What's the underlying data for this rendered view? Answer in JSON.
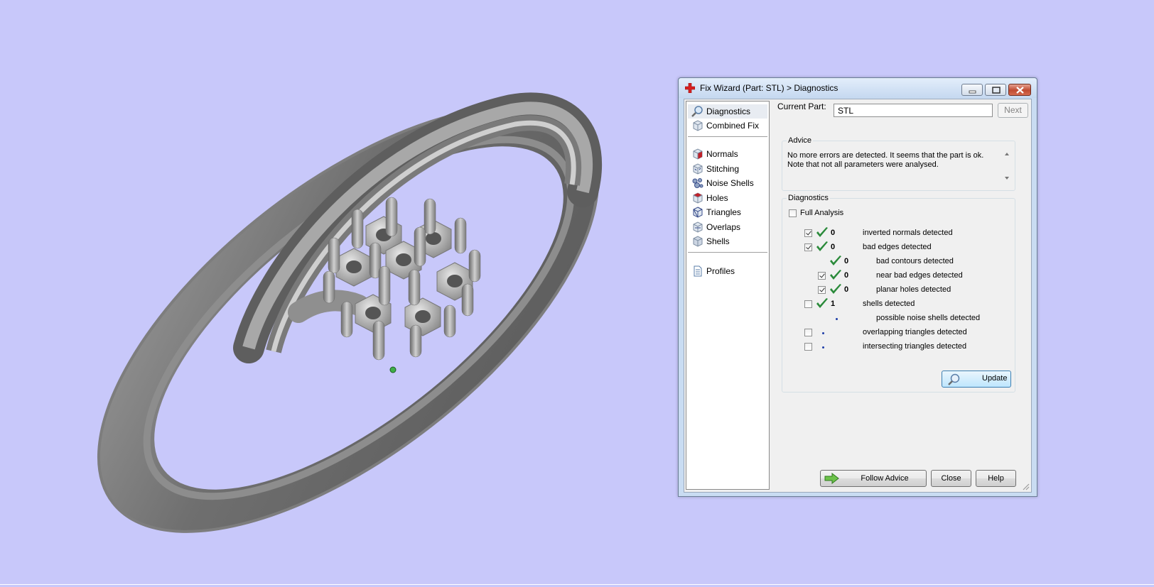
{
  "colors": {
    "viewport_bg": "#c8c8fa",
    "check_green": "#2a8a3a",
    "dot_blue": "#1f3ea8",
    "window_frame": "#c9dcf2"
  },
  "window": {
    "title": "Fix Wizard (Part: STL) > Diagnostics"
  },
  "nav": {
    "top": [
      {
        "label": "Diagnostics",
        "icon": "magnifier-icon",
        "selected": true
      },
      {
        "label": "Combined Fix",
        "icon": "cube-icon"
      }
    ],
    "tools": [
      {
        "label": "Normals",
        "icon": "normals-cube-icon"
      },
      {
        "label": "Stitching",
        "icon": "stitching-cube-icon"
      },
      {
        "label": "Noise Shells",
        "icon": "noise-shells-icon"
      },
      {
        "label": "Holes",
        "icon": "holes-cube-icon"
      },
      {
        "label": "Triangles",
        "icon": "triangles-cube-icon"
      },
      {
        "label": "Overlaps",
        "icon": "overlaps-cube-icon"
      },
      {
        "label": "Shells",
        "icon": "shells-cube-icon"
      }
    ],
    "bottom": [
      {
        "label": "Profiles",
        "icon": "document-icon"
      }
    ]
  },
  "current_part": {
    "label": "Current Part:",
    "value": "STL",
    "next_label": "Next"
  },
  "advice": {
    "title": "Advice",
    "line1": "No more errors are detected. It seems that the part is ok.",
    "line2": "Note that not all parameters were analysed."
  },
  "diagnostics": {
    "title": "Diagnostics",
    "full_analysis_label": "Full Analysis",
    "full_analysis_checked": false,
    "rows": [
      {
        "checkbox": true,
        "checked": true,
        "status": "ok",
        "count": "0",
        "text": "inverted normals detected",
        "indent": 0
      },
      {
        "checkbox": true,
        "checked": true,
        "status": "ok",
        "count": "0",
        "text": "bad edges detected",
        "indent": 0
      },
      {
        "checkbox": false,
        "checked": false,
        "status": "ok",
        "count": "0",
        "text": "bad contours detected",
        "indent": 1
      },
      {
        "checkbox": true,
        "checked": true,
        "status": "ok",
        "count": "0",
        "text": "near bad edges detected",
        "indent": 1
      },
      {
        "checkbox": true,
        "checked": true,
        "status": "ok",
        "count": "0",
        "text": "planar holes detected",
        "indent": 1
      },
      {
        "checkbox": true,
        "checked": false,
        "status": "ok",
        "count": "1",
        "text": "shells detected",
        "indent": 0
      },
      {
        "checkbox": false,
        "checked": false,
        "status": "none",
        "count": "",
        "text": "possible noise shells detected",
        "indent": 1
      },
      {
        "checkbox": true,
        "checked": false,
        "status": "none",
        "count": "",
        "text": "overlapping triangles detected",
        "indent": 0
      },
      {
        "checkbox": true,
        "checked": false,
        "status": "none",
        "count": "",
        "text": "intersecting triangles detected",
        "indent": 0
      }
    ],
    "update_label": "Update"
  },
  "buttons": {
    "follow_advice": "Follow Advice",
    "close": "Close",
    "help": "Help"
  }
}
